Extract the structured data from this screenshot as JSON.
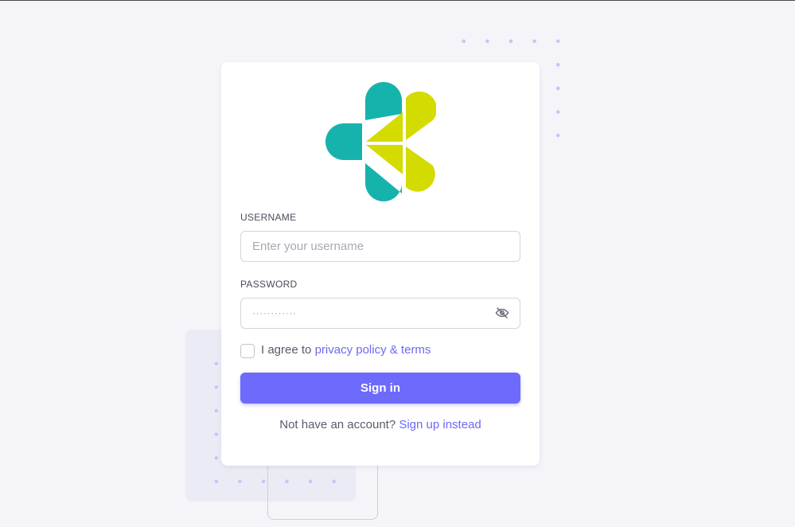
{
  "form": {
    "username_label": "USERNAME",
    "username_placeholder": "Enter your username",
    "password_label": "PASSWORD",
    "password_value": "············",
    "agree_prefix": "I agree to",
    "agree_link": "privacy policy & terms",
    "submit_label": "Sign in",
    "signup_prefix": "Not have an account?",
    "signup_link": "Sign up instead"
  },
  "logo": {
    "icon": "kemenkes-leaf-logo",
    "colors": [
      "#16b3ac",
      "#d4db00"
    ]
  },
  "icons": {
    "password_toggle": "eye-off-icon"
  },
  "colors": {
    "accent": "#6d6afc",
    "background": "#f4f4f9",
    "card": "#ffffff"
  }
}
